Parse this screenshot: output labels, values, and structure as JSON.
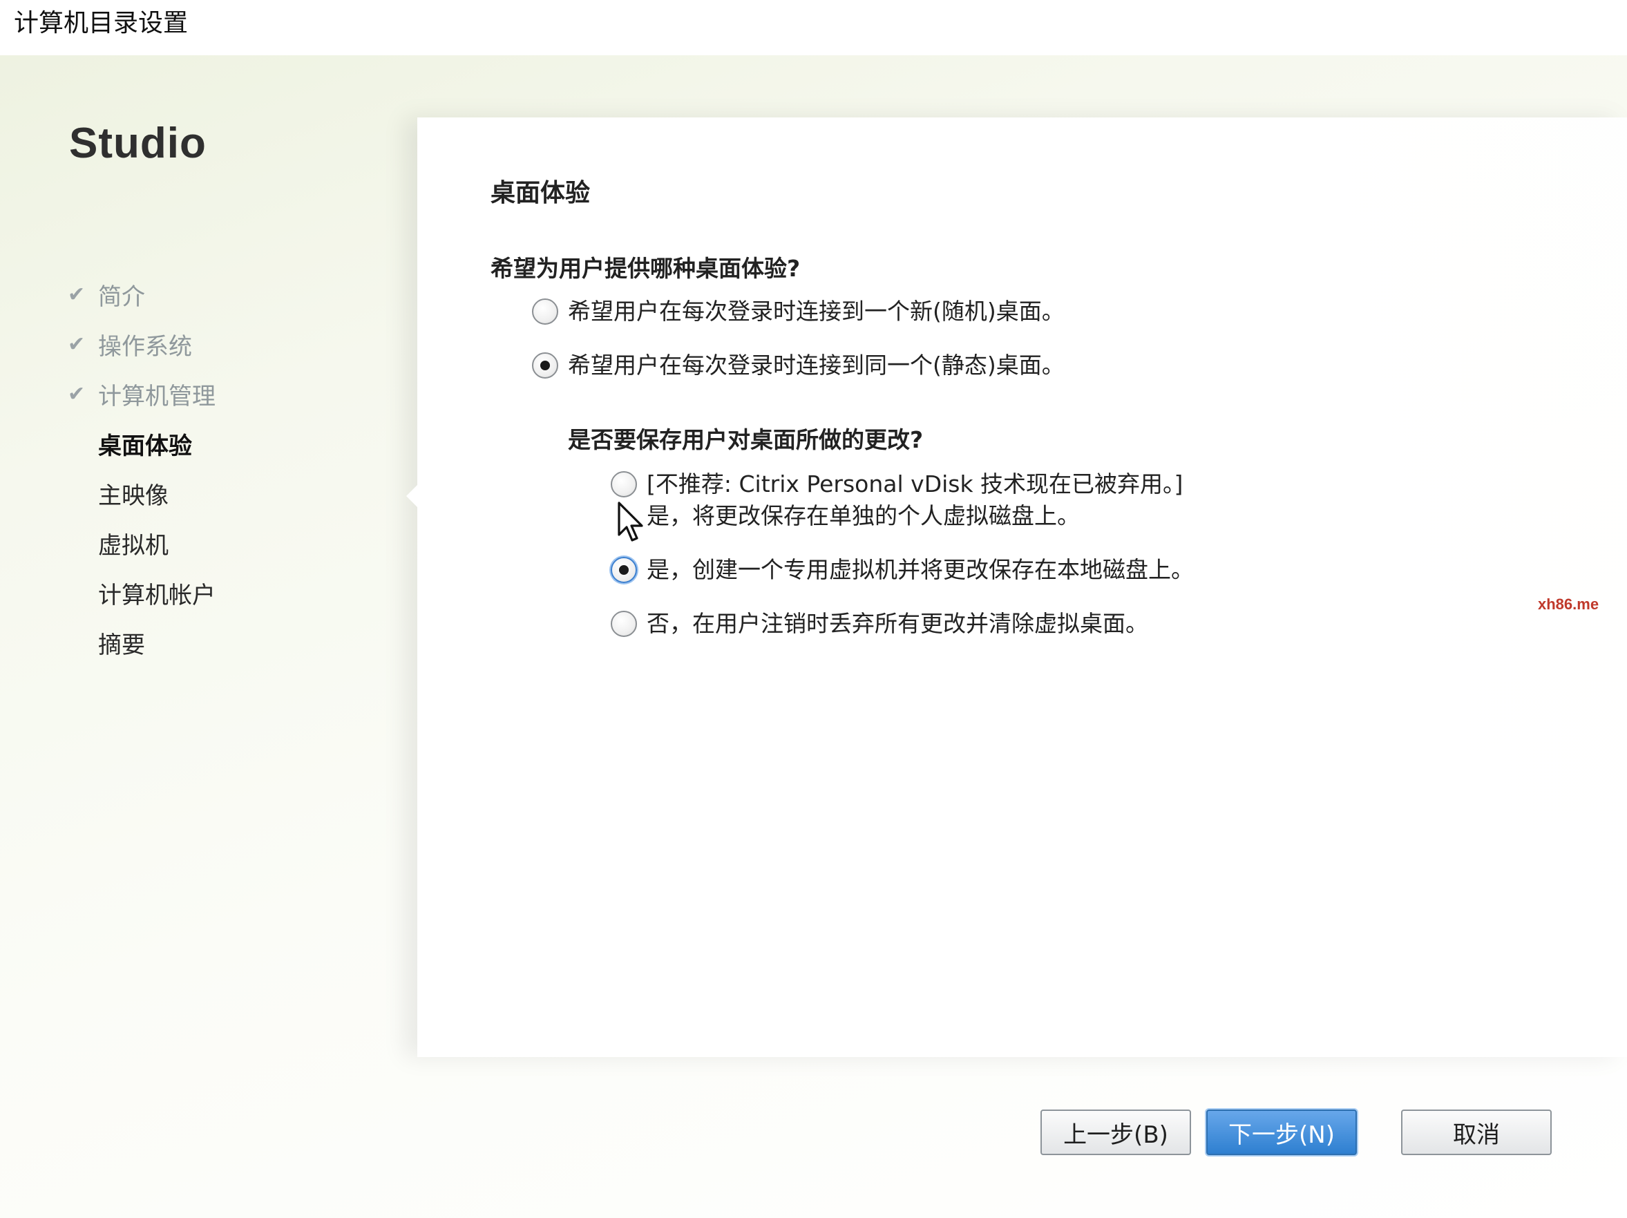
{
  "window": {
    "title": "计算机目录设置"
  },
  "sidebar": {
    "brand": "Studio",
    "steps": [
      {
        "label": "简介",
        "status": "done"
      },
      {
        "label": "操作系统",
        "status": "done"
      },
      {
        "label": "计算机管理",
        "status": "done"
      },
      {
        "label": "桌面体验",
        "status": "current"
      },
      {
        "label": "主映像",
        "status": "pending"
      },
      {
        "label": "虚拟机",
        "status": "pending"
      },
      {
        "label": "计算机帐户",
        "status": "pending"
      },
      {
        "label": "摘要",
        "status": "pending"
      }
    ]
  },
  "main": {
    "heading": "桌面体验",
    "question1": "希望为用户提供哪种桌面体验?",
    "q1_options": [
      {
        "label": "希望用户在每次登录时连接到一个新(随机)桌面。",
        "checked": false
      },
      {
        "label": "希望用户在每次登录时连接到同一个(静态)桌面。",
        "checked": true
      }
    ],
    "question2": "是否要保存用户对桌面所做的更改?",
    "q2_options": [
      {
        "line1": "[不推荐: Citrix Personal vDisk 技术现在已被弃用。]",
        "line2": "是，将更改保存在单独的个人虚拟磁盘上。",
        "checked": false
      },
      {
        "label": "是，创建一个专用虚拟机并将更改保存在本地磁盘上。",
        "checked": true
      },
      {
        "label": "否，在用户注销时丢弃所有更改并清除虚拟桌面。",
        "checked": false
      }
    ]
  },
  "footer": {
    "back_label": "上一步(B)",
    "next_label": "下一步(N)",
    "cancel_label": "取消"
  },
  "watermark": "xh86.me",
  "colors": {
    "accent_button": "#2e7fd0",
    "check_mark": "#9aa2a6",
    "watermark": "#c0392b"
  }
}
